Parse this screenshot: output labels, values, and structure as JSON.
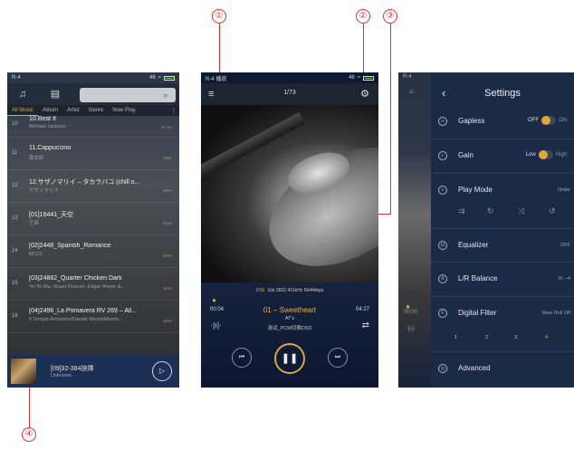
{
  "callouts": [
    "①",
    "②",
    "③",
    "④"
  ],
  "colors": {
    "accent": "#d8a93c",
    "callout": "#e03030",
    "panel": "#1b2a47"
  },
  "library": {
    "status_left": "R-4",
    "status_right": "46",
    "tabs": [
      "All Music",
      "Album",
      "Artist",
      "Genre",
      "Now Play"
    ],
    "tab_more": "⋮",
    "search_icon": "search-icon",
    "rows": [
      {
        "num": "10",
        "title": "10.Beat It",
        "artist": "Michael Jackson",
        "format": "FLAC"
      },
      {
        "num": "11",
        "title": "11.Cappuccino",
        "artist": "蕭玄昕",
        "format": "DSF"
      },
      {
        "num": "12",
        "title": "12.サザノマリイ – タカラバコ (chill o...",
        "artist": "サザノマリイ",
        "format": "MP3"
      },
      {
        "num": "13",
        "title": "[01]16441_天空",
        "artist": "王菲",
        "format": "WAV"
      },
      {
        "num": "14",
        "title": "[02]2448_Spanish_Romance",
        "artist": "MLCC",
        "format": "WAV"
      },
      {
        "num": "15",
        "title": "[03]24882_Quarter Chicken Dark",
        "artist": "Yo-Yo Ma, Stuart Duncan, Edgar Meyer &...",
        "format": "WAV"
      },
      {
        "num": "16",
        "title": "[04]2496_La Primavera RV 269 – All...",
        "artist": "Il Tempio Armonico/Davide Monti/Alberto...",
        "format": "WAV"
      }
    ],
    "mini_player": {
      "title": "[09]32-384抉擇",
      "artist": "Unknown"
    }
  },
  "player": {
    "status_left": "R-4  播放",
    "status_right": "46",
    "track_counter": "1/73",
    "format_dsf": "DSF",
    "format_rest": "1bit  2822.401kHz  5644kbps",
    "time_current": "00:04",
    "time_total": "04:27",
    "song": "01 – Sweetheart",
    "artist": "AT's",
    "album": "测试_PCM切换DSD"
  },
  "settings": {
    "title": "Settings",
    "status_left": "R-4",
    "items": [
      {
        "label": "Gapless",
        "value": ""
      },
      {
        "label": "Gain",
        "value": ""
      },
      {
        "label": "Play Mode",
        "value": "Order"
      },
      {
        "label": "Equalizer",
        "value": "OFF"
      },
      {
        "label": "L/R Balance",
        "value": "R: –4"
      },
      {
        "label": "Digital Filter",
        "value": "Slow Roll Off"
      },
      {
        "label": "Advanced",
        "value": ""
      }
    ],
    "gapless_off": "OFF",
    "gapless_on": "ON",
    "gain_low": "Low",
    "gain_high": "High",
    "filters": [
      "1",
      "2",
      "3",
      "4"
    ],
    "behind_time": "00:00"
  }
}
